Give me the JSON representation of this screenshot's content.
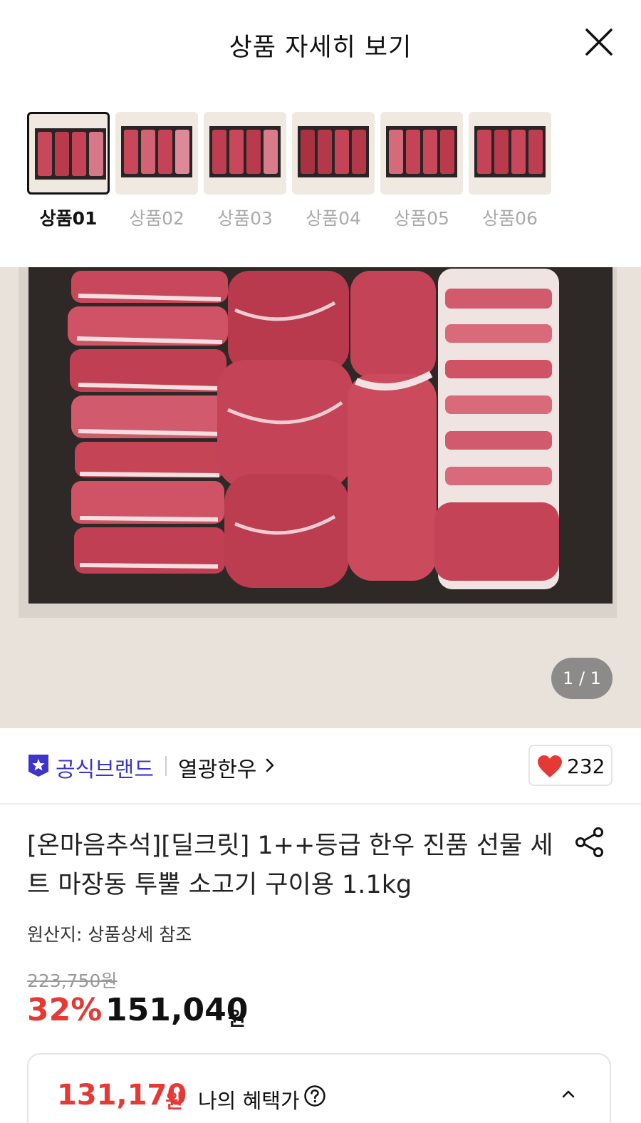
{
  "header": {
    "title": "상품 자세히 보기",
    "close_icon": "close-icon"
  },
  "thumbnails": [
    {
      "label": "상품01",
      "active": true
    },
    {
      "label": "상품02",
      "active": false
    },
    {
      "label": "상품03",
      "active": false
    },
    {
      "label": "상품04",
      "active": false
    },
    {
      "label": "상품05",
      "active": false
    },
    {
      "label": "상품06",
      "active": false
    }
  ],
  "hero": {
    "page_counter": "1 / 1"
  },
  "brand": {
    "badge_icon": "star-badge-icon",
    "label": "공식브랜드",
    "name": "열광한우",
    "chevron_icon": "chevron-right-icon"
  },
  "like": {
    "icon": "heart-icon",
    "count": "232"
  },
  "product": {
    "title": "[온마음추석][딜크릿] 1++등급 한우 진품 선물 세트 마장동 투뿔 소고기 구이용 1.1kg",
    "share_icon": "share-icon",
    "origin": "원산지: 상품상세 참조"
  },
  "price": {
    "original": "223,750원",
    "discount": "32%",
    "sale": "151,040",
    "unit": "원"
  },
  "benefit": {
    "price": "131,170",
    "unit": "원",
    "label": "나의 혜택가",
    "help_icon": "question-circle-icon",
    "collapse_icon": "chevron-up-icon"
  },
  "colors": {
    "brand_accent": "#3d34c9",
    "discount_red": "#e53935",
    "heart_red": "#e53935"
  }
}
